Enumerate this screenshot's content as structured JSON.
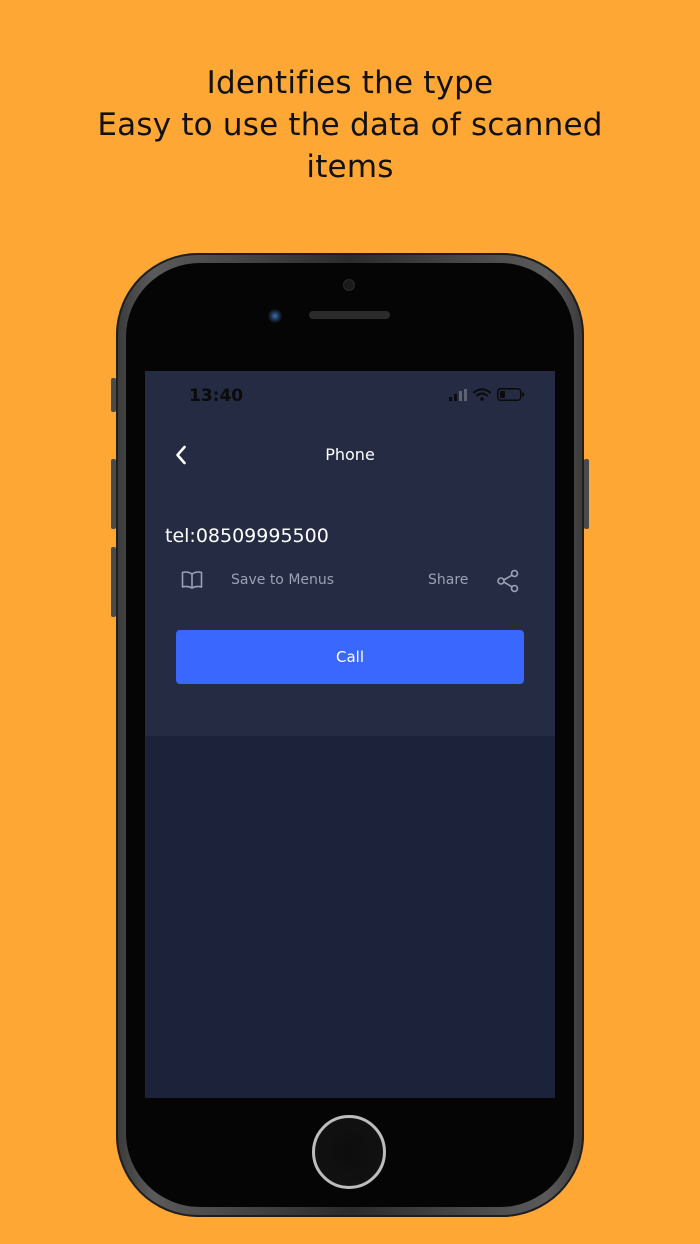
{
  "promo": {
    "line1": "Identifies the type",
    "line2": "Easy to use the data of scanned",
    "line3": "items"
  },
  "status_bar": {
    "time": "13:40",
    "icons": [
      "signal-icon",
      "wifi-icon",
      "battery-icon"
    ]
  },
  "nav": {
    "title": "Phone",
    "back_icon": "chevron-left-icon"
  },
  "result": {
    "value": "tel:08509995500"
  },
  "actions": {
    "save_label": "Save to Menus",
    "save_icon": "book-icon",
    "share_label": "Share",
    "share_icon": "share-icon"
  },
  "primary_action": {
    "label": "Call"
  },
  "colors": {
    "background": "#FFA734",
    "screen": "#1C2239",
    "card": "#242B42",
    "accent": "#3A68FF",
    "muted_text": "#9BA2B6"
  }
}
